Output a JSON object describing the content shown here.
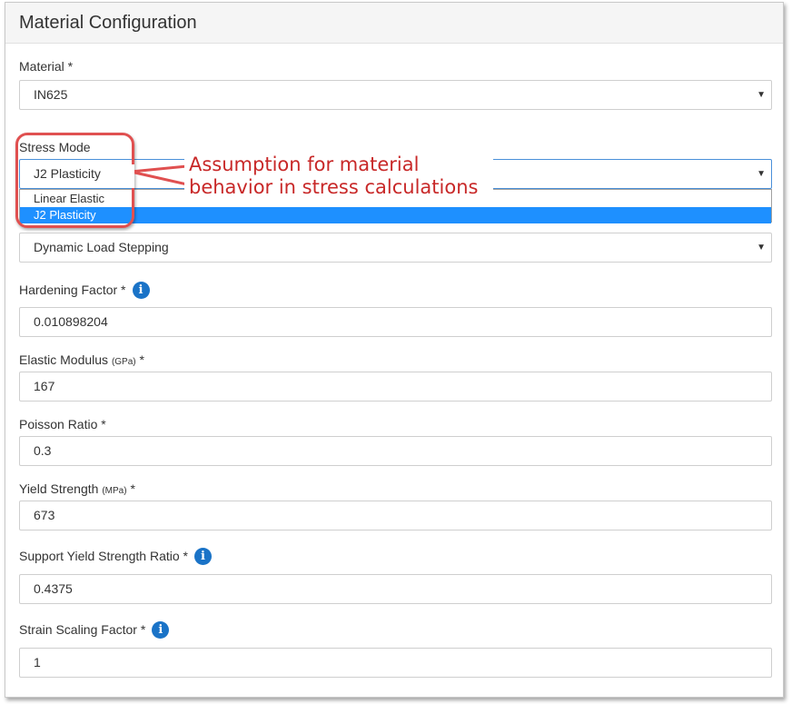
{
  "panel": {
    "title": "Material Configuration"
  },
  "fields": {
    "material": {
      "label": "Material *",
      "value": "IN625"
    },
    "stress_mode": {
      "label": "Stress Mode",
      "value": "J2 Plasticity",
      "options": [
        "Linear Elastic",
        "J2 Plasticity"
      ],
      "selected_option": "J2 Plasticity"
    },
    "load_stepping": {
      "value": "Dynamic Load Stepping"
    },
    "hardening_factor": {
      "label": "Hardening Factor *",
      "value": "0.010898204"
    },
    "elastic_modulus": {
      "label": "Elastic Modulus",
      "unit": "(GPa)",
      "required": "*",
      "value": "167"
    },
    "poisson_ratio": {
      "label": "Poisson Ratio *",
      "value": "0.3"
    },
    "yield_strength": {
      "label": "Yield Strength",
      "unit": "(MPa)",
      "required": "*",
      "value": "673"
    },
    "support_yield_strength_ratio": {
      "label": "Support Yield Strength Ratio *",
      "value": "0.4375"
    },
    "strain_scaling_factor": {
      "label": "Strain Scaling Factor *",
      "value": "1"
    }
  },
  "annotation": {
    "line1": "Assumption for material",
    "line2": "behavior in stress calculations",
    "color": "#c82828"
  },
  "icons": {
    "info": "i",
    "caret": "▼"
  },
  "colors": {
    "accent": "#1a73c7",
    "selected_option_bg": "#1e90ff",
    "callout_border": "#e05050"
  }
}
